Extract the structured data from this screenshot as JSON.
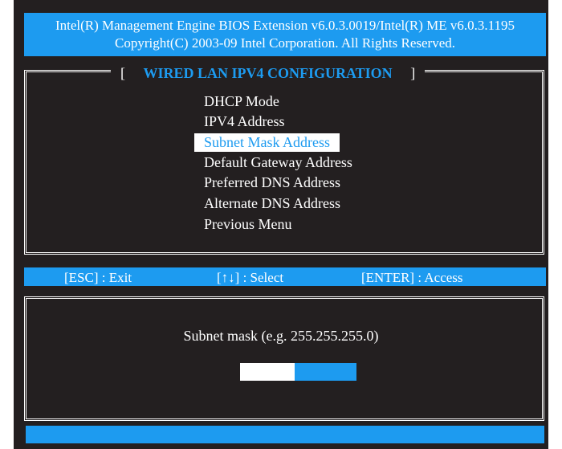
{
  "header": {
    "line1": "Intel(R) Management Engine BIOS Extension v6.0.3.0019/Intel(R) ME v6.0.3.1195",
    "line2": "Copyright(C) 2003-09 Intel Corporation. All Rights Reserved."
  },
  "menu": {
    "bracket_open": "[",
    "title": "WIRED LAN IPV4 CONFIGURATION",
    "bracket_close": "]",
    "items": [
      {
        "label": "DHCP Mode"
      },
      {
        "label": "IPV4 Address"
      },
      {
        "label": "Subnet Mask Address"
      },
      {
        "label": "Default Gateway Address"
      },
      {
        "label": "Preferred DNS Address"
      },
      {
        "label": "Alternate DNS Address"
      },
      {
        "label": "Previous Menu"
      }
    ],
    "selected_index": 2
  },
  "help": {
    "esc": "[ESC] : Exit",
    "select": "[↑↓] : Select",
    "enter": "[ENTER] : Access"
  },
  "prompt": {
    "text": "Subnet mask (e.g. 255.255.255.0)",
    "value": ""
  },
  "colors": {
    "background": "#231f20",
    "accent_blue": "#1d9bf0",
    "text": "#ffffff"
  }
}
